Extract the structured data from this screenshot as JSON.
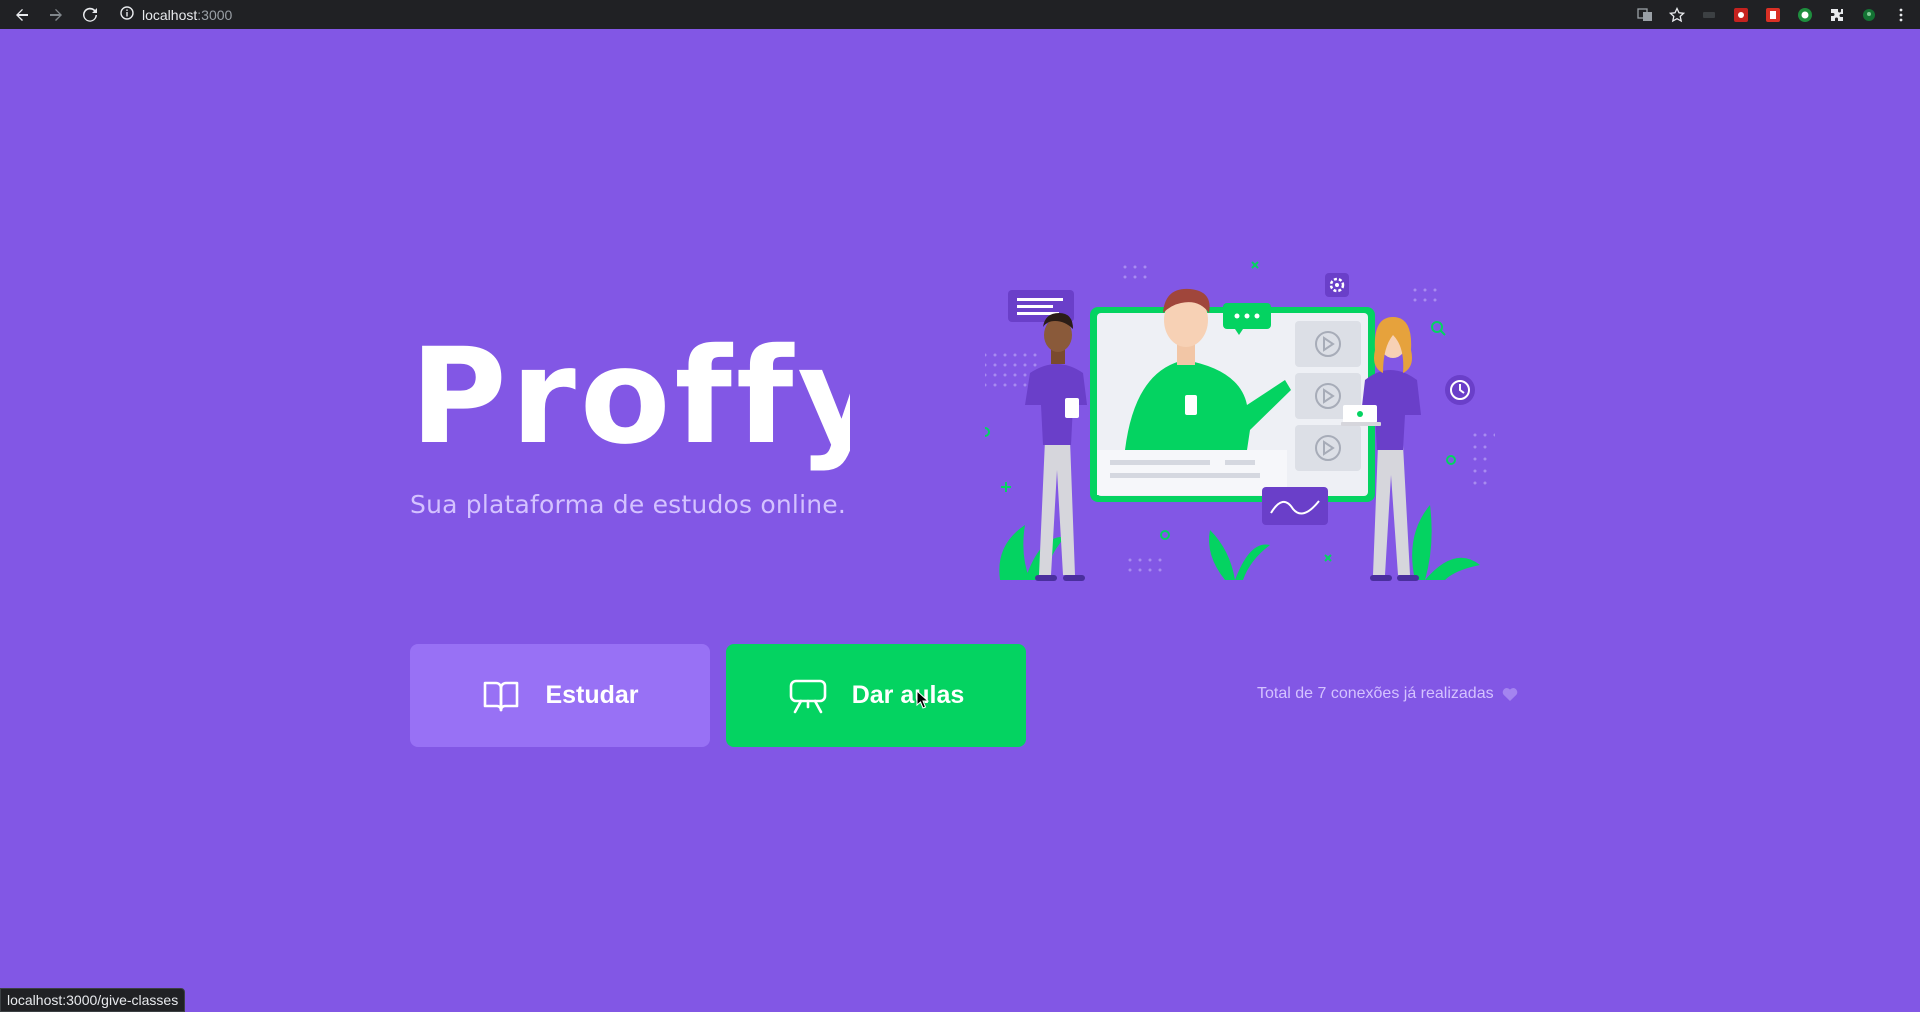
{
  "browser": {
    "url_host": "localhost",
    "url_port": ":3000",
    "status_url": "localhost:3000/give-classes"
  },
  "landing": {
    "logo_text": "Proffy",
    "tagline": "Sua plataforma de estudos online.",
    "buttons": {
      "study_label": "Estudar",
      "give_classes_label": "Dar aulas"
    },
    "connections_text": "Total de 7 conexões já realizadas"
  },
  "colors": {
    "background": "#8257e5",
    "study_button": "#9871f5",
    "give_button": "#04d361",
    "text_soft": "#d4c2ff"
  }
}
